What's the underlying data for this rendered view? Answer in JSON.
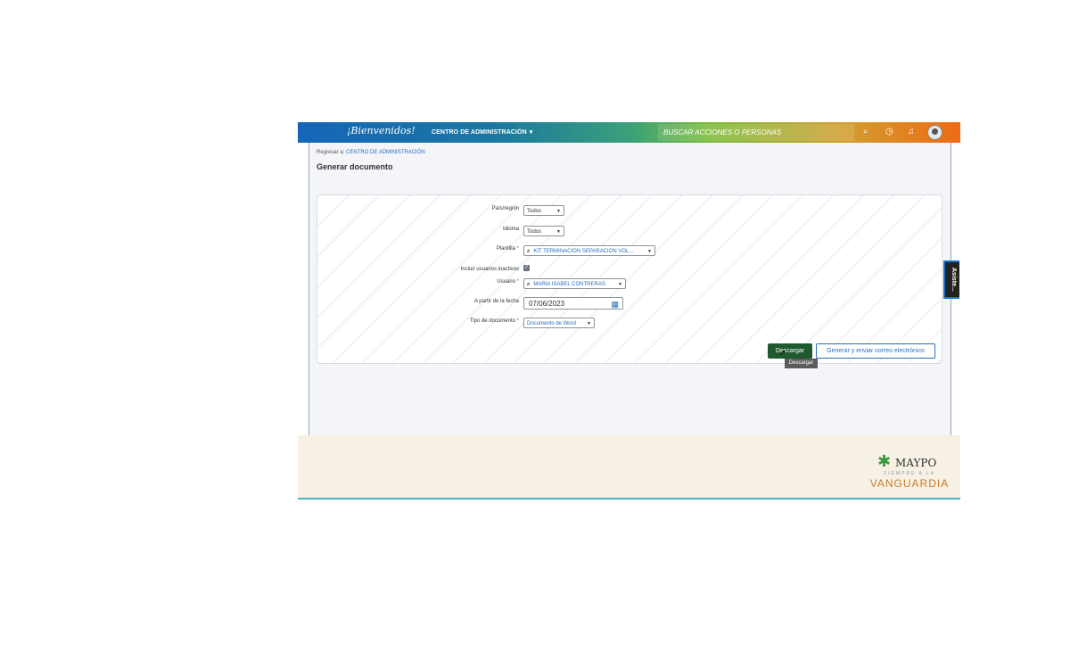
{
  "topbar": {
    "welcome": "¡Bienvenidos!",
    "admin_menu": "CENTRO DE ADMINISTRACIÓN",
    "admin_caret": "▾",
    "search_placeholder": "BUSCAR ACCIONES O PERSONAS",
    "icons": [
      "search-icon",
      "clock-icon",
      "bell-icon",
      "avatar"
    ]
  },
  "breadcrumb": {
    "prefix": "Regresar a:",
    "link": "CENTRO DE ADMINISTRACIÓN"
  },
  "page_title": "Generar documento",
  "form": {
    "country": {
      "label": "País/región",
      "value": "Todos"
    },
    "language": {
      "label": "Idioma",
      "value": "Todos"
    },
    "template": {
      "label": "Plantilla",
      "required": "*",
      "value": "KIT TERMINACION SEPARACION VOL..."
    },
    "inactive": {
      "label": "Incluir usuarios inactivos",
      "checked": true
    },
    "user": {
      "label": "Usuario",
      "required": "*",
      "value": "MARIA ISABEL CONTRERAS"
    },
    "date": {
      "label": "A partir de la fecha",
      "value": "07/06/2023"
    },
    "doc_type": {
      "label": "Tipo de documento",
      "required": "*",
      "value": "Documento de Word"
    }
  },
  "buttons": {
    "download": "Descargar",
    "generate_send": "Generar y enviar correo electrónico",
    "tooltip": "Descargar"
  },
  "side_tab": "Asiste...",
  "footer": {
    "brand": "MAYPO",
    "tagline": "SIEMPRE A LA",
    "slogan": "VANGUARDIA"
  },
  "colors": {
    "primary_button": "#1f5a2e",
    "link": "#2a6ebb",
    "footer_bg": "#f6f1e4"
  }
}
